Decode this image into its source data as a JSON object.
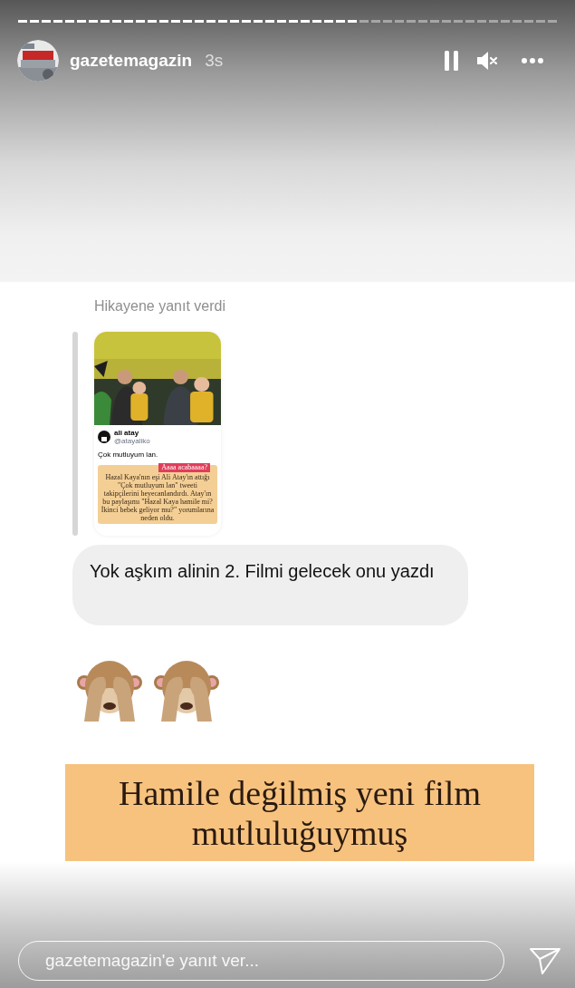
{
  "story_progress": {
    "level": 0.63
  },
  "header": {
    "username": "gazetemagazin",
    "time": "3s"
  },
  "reply_label": "Hikayene yanıt verdi",
  "story_preview": {
    "author_name": "ali atay",
    "author_handle": "@atayaliko",
    "tweet": "Çok mutluyum lan.",
    "badge": "Aaaa acabaaaa?",
    "caption": "Hazal Kaya'nın eşi Ali Atay'ın attığı \"Çok mutluyum lan\" tweeti takipçilerini heyecanlandırdı. Atay'ın bu paylaşımı \"Hazal Kaya hamile mi? İkinci bebek geliyor mu?\" yorumlarına neden oldu."
  },
  "message": "Yok aşkım alinin 2. Filmi gelecek onu yazdı",
  "banner": {
    "lines": [
      "Hamile değilmiş yeni film",
      "mutluluğuymuş"
    ]
  },
  "reply_field": {
    "placeholder": "gazetemagazin'e yanıt ver..."
  }
}
